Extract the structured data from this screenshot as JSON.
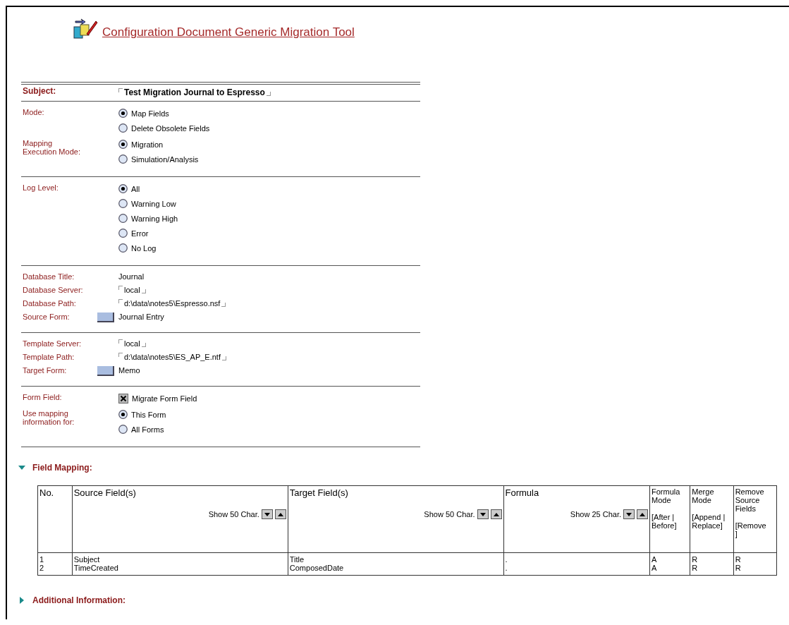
{
  "title": "Configuration Document Generic Migration Tool",
  "sections": [
    {
      "rows": [
        {
          "label": "Subject:",
          "kind": "subject",
          "value": "Test Migration Journal to Espresso"
        }
      ]
    },
    {
      "rows": [
        {
          "label": "Mode:",
          "kind": "radio",
          "options": [
            {
              "label": "Map Fields",
              "selected": true
            },
            {
              "label": "Delete Obsolete Fields",
              "selected": false
            }
          ]
        },
        {
          "label": "Mapping\nExecution Mode:",
          "kind": "radio",
          "options": [
            {
              "label": "Migration",
              "selected": true
            },
            {
              "label": "Simulation/Analysis",
              "selected": false
            }
          ]
        }
      ]
    },
    {
      "rows": [
        {
          "label": "Log Level:",
          "kind": "radio",
          "options": [
            {
              "label": "All",
              "selected": true
            },
            {
              "label": "Warning Low",
              "selected": false
            },
            {
              "label": "Warning High",
              "selected": false
            },
            {
              "label": "Error",
              "selected": false
            },
            {
              "label": "No Log",
              "selected": false
            }
          ]
        }
      ]
    },
    {
      "rows": [
        {
          "label": "Database Title:",
          "kind": "text",
          "value": "Journal"
        },
        {
          "label": "Database Server:",
          "kind": "field",
          "value": "local"
        },
        {
          "label": "Database Path:",
          "kind": "field",
          "value": "d:\\data\\notes5\\Espresso.nsf"
        },
        {
          "label": "Source Form:",
          "kind": "picker",
          "value": "Journal Entry"
        }
      ]
    },
    {
      "rows": [
        {
          "label": "Template Server:",
          "kind": "field",
          "value": "local"
        },
        {
          "label": "Template Path:",
          "kind": "field",
          "value": "d:\\data\\notes5\\ES_AP_E.ntf"
        },
        {
          "label": "Target Form:",
          "kind": "picker",
          "value": "Memo"
        }
      ]
    },
    {
      "rows": [
        {
          "label": "Form Field:",
          "kind": "checkbox",
          "options": [
            {
              "label": "Migrate Form Field",
              "checked": true
            }
          ]
        },
        {
          "label": "Use mapping\ninformation for:",
          "kind": "radio",
          "options": [
            {
              "label": "This Form",
              "selected": true
            },
            {
              "label": "All Forms",
              "selected": false
            }
          ]
        }
      ]
    }
  ],
  "field_mapping": {
    "title": "Field Mapping:",
    "expanded": true,
    "columns": [
      {
        "title": "No."
      },
      {
        "title": "Source Field(s)",
        "show": "Show 50 Char."
      },
      {
        "title": "Target Field(s)",
        "show": "Show 50 Char."
      },
      {
        "title": "Formula",
        "show": "Show 25 Char."
      },
      {
        "title": "Formula\nMode",
        "hint": "[After |\nBefore]"
      },
      {
        "title": "Merge\nMode",
        "hint": "[Append |\nReplace]"
      },
      {
        "title": "Remove\nSource\nFields",
        "hint": "[Remove\n]"
      }
    ],
    "rows": [
      [
        "1",
        "Subject",
        "Title",
        ".",
        "A",
        "R",
        "R"
      ],
      [
        "2",
        "TimeCreated",
        "ComposedDate",
        ".",
        "A",
        "R",
        "R"
      ]
    ]
  },
  "additional": {
    "title": "Additional Information:",
    "expanded": false
  }
}
